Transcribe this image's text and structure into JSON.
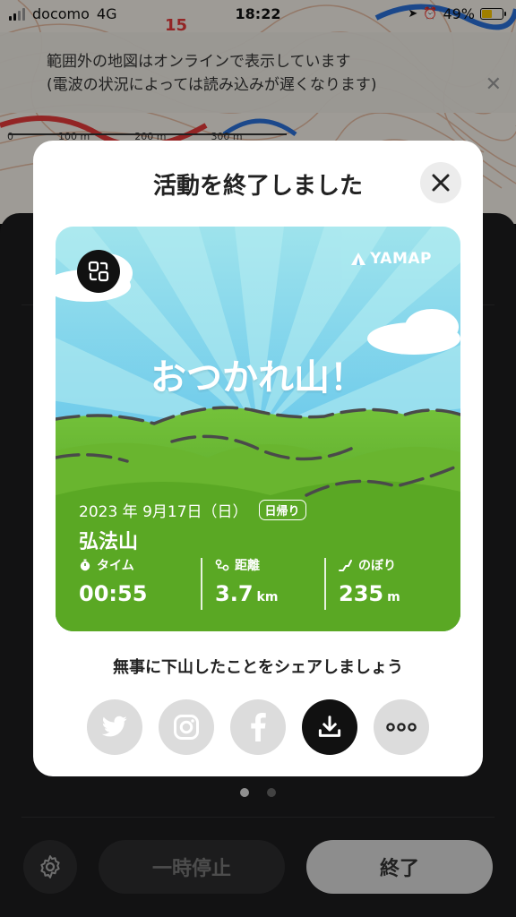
{
  "status_bar": {
    "carrier": "docomo",
    "network": "4G",
    "time": "18:22",
    "battery": "49%",
    "battery_level": 0.49,
    "battery_color": "#f5c400"
  },
  "banner": {
    "line1": "範囲外の地図はオンラインで表示しています",
    "line2": "(電波の状況によっては読み込みが遅くなります)"
  },
  "map": {
    "scale_labels": [
      "0",
      "100 m",
      "200 m",
      "300 m"
    ],
    "marker_number": "15"
  },
  "modal": {
    "title": "活動を終了しました",
    "card": {
      "brand": "YAMAP",
      "headline": "おつかれ山！",
      "date": "2023 年 9月17日（日）",
      "badge": "日帰り",
      "mountain": "弘法山",
      "stats": [
        {
          "label": "タイム",
          "value": "00:55",
          "unit": "",
          "icon": "stopwatch-icon"
        },
        {
          "label": "距離",
          "value": "3.7",
          "unit": "km",
          "icon": "route-icon"
        },
        {
          "label": "のぼり",
          "value": "235",
          "unit": "m",
          "icon": "ascent-icon"
        }
      ]
    },
    "share_text": "無事に下山したことをシェアしましょう",
    "share_buttons": [
      "twitter-icon",
      "instagram-icon",
      "facebook-icon",
      "download-icon",
      "more-icon"
    ]
  },
  "bottom": {
    "pause_label": "一時停止",
    "end_label": "終了"
  },
  "colors": {
    "sky_top": "#8fdcf0",
    "grass": "#5aa824",
    "accent": "#111111"
  }
}
